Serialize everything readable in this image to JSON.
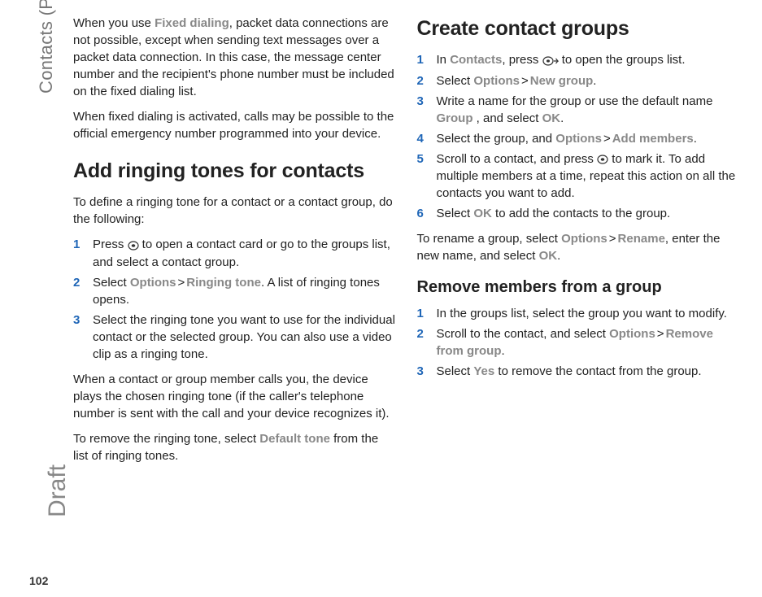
{
  "meta": {
    "sidebar_label": "Contacts (Phonebook)",
    "draft_label": "Draft",
    "page_number": "102"
  },
  "left": {
    "fixed_p1_a": "When you use ",
    "fixed_p1_b": "Fixed dialing",
    "fixed_p1_c": ", packet data connections are not possible, except when sending text messages over a packet data connection. In this case, the message center number and the recipient's phone number must be included on the fixed dialing list.",
    "fixed_p2": "When fixed dialing is activated, calls may be possible to the official emergency number programmed into your device.",
    "ring_h1": "Add ringing tones for contacts",
    "ring_intro": "To define a ringing tone for a contact or a contact group, do the following:",
    "ring_steps": [
      {
        "num": "1",
        "before": "Press ",
        "after": " to open a contact card or go to the groups list, and select a contact group."
      },
      {
        "num": "2",
        "a": "Select ",
        "b": "Options",
        "c": " > ",
        "d": "Ringing tone",
        "e": ". A list of ringing tones opens."
      },
      {
        "num": "3",
        "text": "Select the ringing tone you want to use for the individual contact or the selected group. You can also use a video clip as a ringing tone."
      }
    ],
    "ring_p3": "When a contact or group member calls you, the device plays the chosen ringing tone (if the caller's telephone number is sent with the call and your device recognizes it).",
    "ring_p4_a": "To remove the ringing tone, select ",
    "ring_p4_b": "Default tone",
    "ring_p4_c": " from the list of ringing tones."
  },
  "right": {
    "groups_h1": "Create contact groups",
    "g_steps": [
      {
        "num": "1",
        "a": "In ",
        "b": "Contacts",
        "c": ", press ",
        "d": " to open the groups list."
      },
      {
        "num": "2",
        "a": "Select ",
        "b": "Options",
        "c": " > ",
        "d": "New group",
        "e": "."
      },
      {
        "num": "3",
        "a": "Write a name for the group or use the default name ",
        "b": "Group",
        "c": " , and select ",
        "d": "OK",
        "e": "."
      },
      {
        "num": "4",
        "a": "Select the group, and ",
        "b": "Options",
        "c": " > ",
        "d": "Add members",
        "e": "."
      },
      {
        "num": "5",
        "a": "Scroll to a contact, and press ",
        "b": " to mark it. To add multiple members at a time, repeat this action on all the contacts you want to add."
      },
      {
        "num": "6",
        "a": "Select ",
        "b": "OK",
        "c": " to add the contacts to the group."
      }
    ],
    "rename_a": "To rename a group, select ",
    "rename_b": "Options",
    "rename_c": " > ",
    "rename_d": "Rename",
    "rename_e": ", enter the new name, and select ",
    "rename_f": "OK",
    "rename_g": ".",
    "remove_h2": "Remove members from a group",
    "r_steps": [
      {
        "num": "1",
        "text": "In the groups list, select the group you want to modify."
      },
      {
        "num": "2",
        "a": "Scroll to the contact, and select ",
        "b": "Options",
        "c": " > ",
        "d": "Remove from group",
        "e": "."
      },
      {
        "num": "3",
        "a": "Select ",
        "b": "Yes",
        "c": " to remove the contact from the group."
      }
    ]
  },
  "gt": ">"
}
